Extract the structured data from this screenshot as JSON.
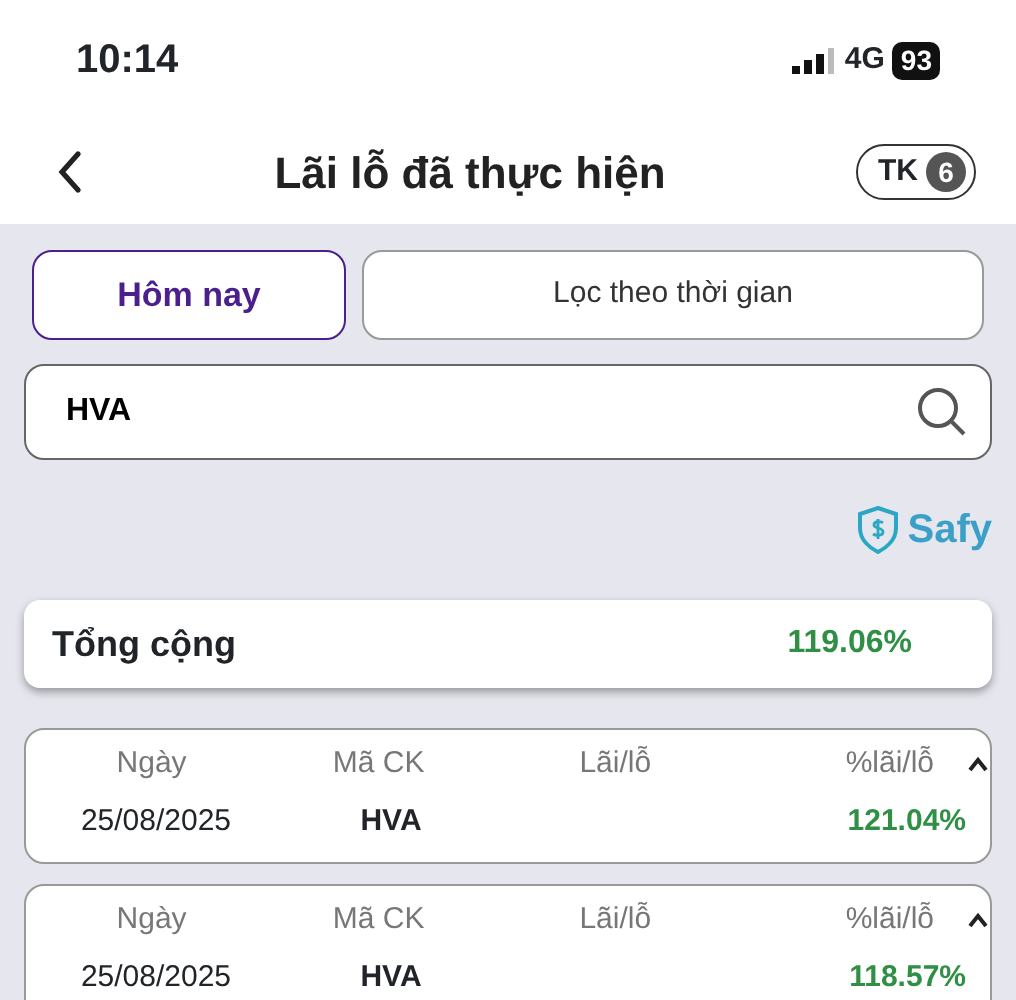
{
  "status_bar": {
    "time": "10:14",
    "network": "4G",
    "battery": "93"
  },
  "header": {
    "title": "Lãi lỗ đã thực hiện",
    "account_label": "TK",
    "account_number": "6"
  },
  "tabs": [
    {
      "label": "Hôm nay",
      "selected": true
    },
    {
      "label": "Lọc theo thời gian",
      "selected": false
    }
  ],
  "search": {
    "value": "HVA"
  },
  "brand": "Safy",
  "total": {
    "label": "Tổng cộng",
    "value": "119.06%"
  },
  "records": [
    {
      "expanded": true,
      "columns": [
        "Ngày",
        "Mã CK",
        "Lãi/lỗ",
        "%lãi/lỗ"
      ],
      "date": "25/08/2025",
      "symbol": "HVA",
      "percent": "121.04%"
    },
    {
      "expanded": true,
      "columns": [
        "Ngày",
        "Mã CK",
        "Lãi/lỗ",
        "%lãi/lỗ"
      ],
      "date": "25/08/2025",
      "symbol": "HVA",
      "percent": "118.57%"
    }
  ]
}
